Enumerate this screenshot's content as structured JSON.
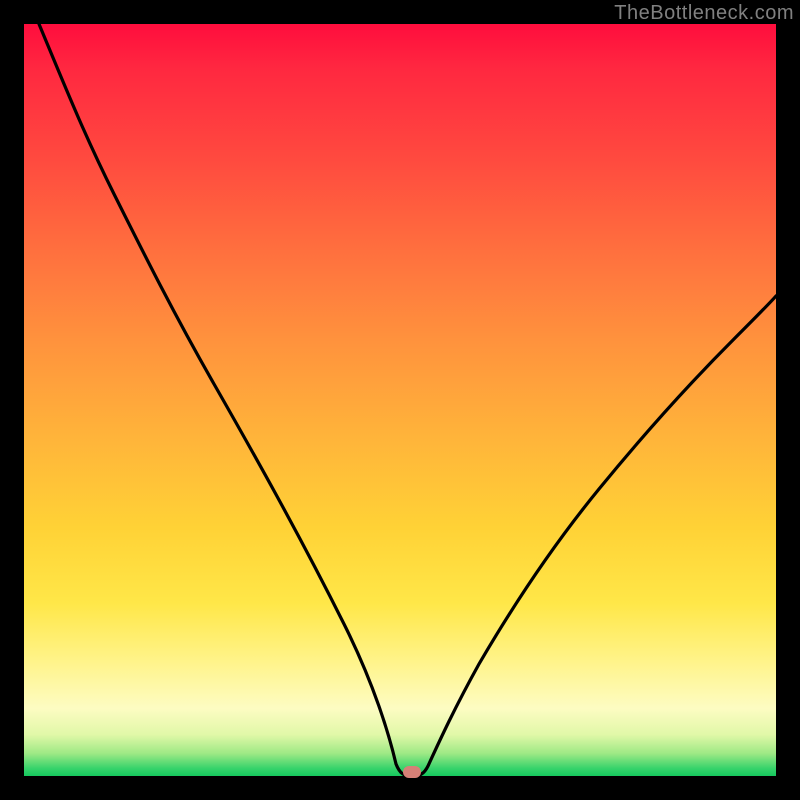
{
  "watermark": "TheBottleneck.com",
  "chart_data": {
    "type": "line",
    "title": "",
    "xlabel": "",
    "ylabel": "",
    "xlim": [
      0,
      100
    ],
    "ylim": [
      0,
      100
    ],
    "grid": false,
    "legend": false,
    "series": [
      {
        "name": "bottleneck-curve",
        "x": [
          2,
          5,
          10,
          15,
          20,
          25,
          30,
          35,
          40,
          45,
          48,
          50,
          52,
          55,
          60,
          65,
          70,
          75,
          80,
          85,
          90,
          95,
          100
        ],
        "values": [
          100,
          95,
          87,
          79,
          71,
          62,
          53,
          44,
          34,
          21,
          8,
          0,
          0,
          5,
          13,
          20,
          27,
          33,
          39,
          45,
          50,
          55,
          60
        ]
      }
    ],
    "marker": {
      "x": 51,
      "y": 0
    },
    "gradient_stops": [
      {
        "pos": 0,
        "color": "#ff0d3d"
      },
      {
        "pos": 0.18,
        "color": "#ff4a3f"
      },
      {
        "pos": 0.42,
        "color": "#ff923d"
      },
      {
        "pos": 0.67,
        "color": "#ffd236"
      },
      {
        "pos": 0.85,
        "color": "#fff48c"
      },
      {
        "pos": 0.97,
        "color": "#9ee985"
      },
      {
        "pos": 1.0,
        "color": "#16c85e"
      }
    ]
  }
}
